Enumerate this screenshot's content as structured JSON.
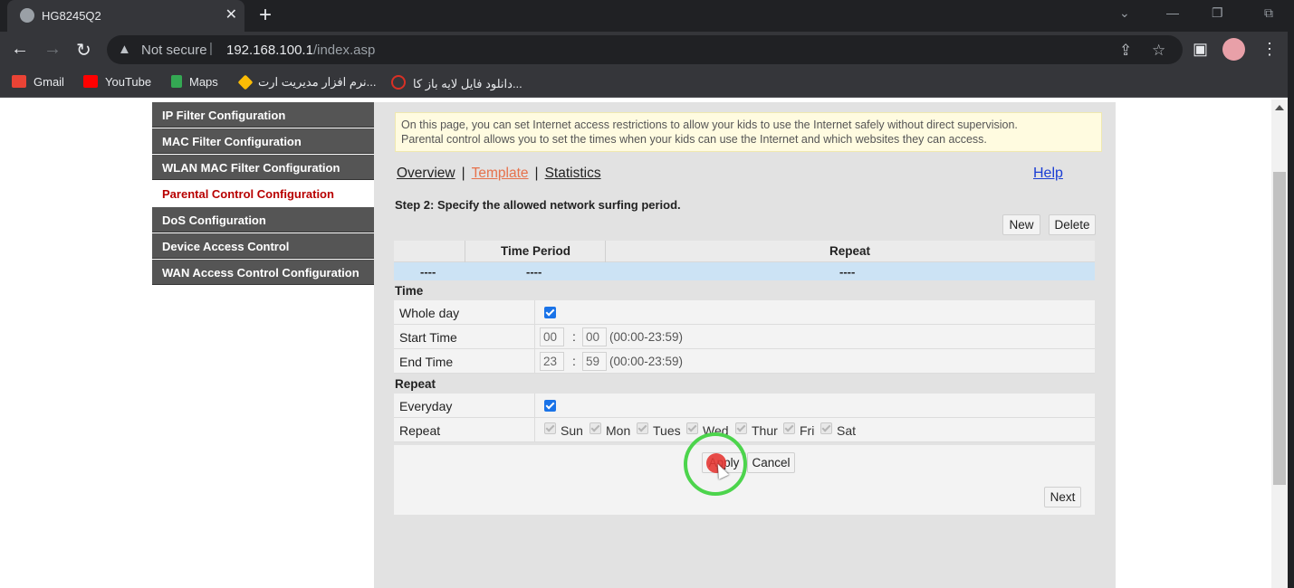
{
  "browser": {
    "tab_title": "HG8245Q2",
    "tab_close": "✕",
    "new_tab": "+",
    "security_label": "Not secure",
    "url_host": "192.168.100.1",
    "url_path": "/index.asp",
    "bookmarks": [
      {
        "label": "Gmail",
        "icon": "gmail-icon",
        "color": "#ea4335"
      },
      {
        "label": "YouTube",
        "icon": "youtube-icon",
        "color": "#ff0000"
      },
      {
        "label": "Maps",
        "icon": "maps-icon",
        "color": "#34a853"
      },
      {
        "label": "نرم افزار مدیریت ارت...",
        "icon": "app-icon",
        "color": "#fbbc05"
      },
      {
        "label": "دانلود فایل لایه باز کا...",
        "icon": "download-icon",
        "color": "#d93025"
      }
    ]
  },
  "sidebar": {
    "items": [
      {
        "label": "IP Filter Configuration",
        "active": false
      },
      {
        "label": "MAC Filter Configuration",
        "active": false
      },
      {
        "label": "WLAN MAC Filter Configuration",
        "active": false
      },
      {
        "label": "Parental Control Configuration",
        "active": true
      },
      {
        "label": "DoS Configuration",
        "active": false
      },
      {
        "label": "Device Access Control",
        "active": false
      },
      {
        "label": "WAN Access Control Configuration",
        "active": false
      }
    ]
  },
  "main": {
    "info_line1": "On this page, you can set Internet access restrictions to allow your kids to use the Internet safely without direct supervision.",
    "info_line2": "Parental control allows you to set the times when your kids can use the Internet and which websites they can access.",
    "nav": {
      "overview": "Overview",
      "template": "Template",
      "statistics": "Statistics",
      "separator": "|"
    },
    "help": "Help",
    "step_title": "Step 2: Specify the allowed network surfing period.",
    "new_button": "New",
    "delete_button": "Delete",
    "table": {
      "headers": [
        "",
        "Time Period",
        "Repeat"
      ],
      "row": [
        "----",
        "----",
        "----"
      ]
    },
    "time_section": "Time",
    "whole_day_label": "Whole day",
    "whole_day_checked": true,
    "start_time_label": "Start Time",
    "start_hour": "00",
    "start_min": "00",
    "end_time_label": "End Time",
    "end_hour": "23",
    "end_min": "59",
    "time_colon": ":",
    "time_hint": "(00:00-23:59)",
    "repeat_section": "Repeat",
    "everyday_label": "Everyday",
    "everyday_checked": true,
    "repeat_label": "Repeat",
    "days": [
      "Sun",
      "Mon",
      "Tues",
      "Wed",
      "Thur",
      "Fri",
      "Sat"
    ],
    "apply_button": "Apply",
    "cancel_button": "Cancel",
    "next_button": "Next"
  }
}
